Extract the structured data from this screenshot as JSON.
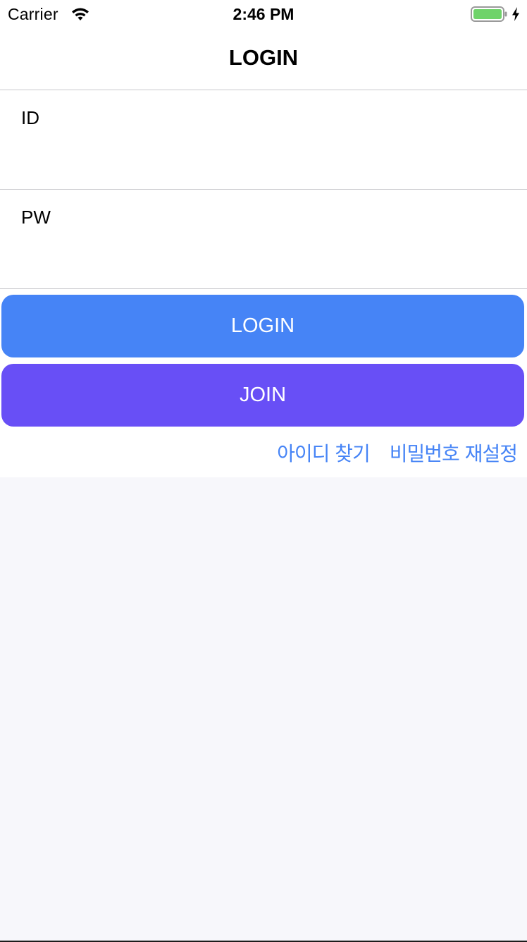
{
  "status_bar": {
    "carrier": "Carrier",
    "time": "2:46 PM",
    "battery_color": "#6fd36a"
  },
  "nav": {
    "title": "LOGIN"
  },
  "form": {
    "id_label": "ID",
    "id_value": "",
    "pw_label": "PW",
    "pw_value": ""
  },
  "buttons": {
    "login_label": "LOGIN",
    "login_color": "#4684f6",
    "join_label": "JOIN",
    "join_color": "#684ff6"
  },
  "links": {
    "find_id": "아이디 찾기",
    "reset_password": "비밀번호 재설정",
    "link_color": "#4684f6"
  }
}
